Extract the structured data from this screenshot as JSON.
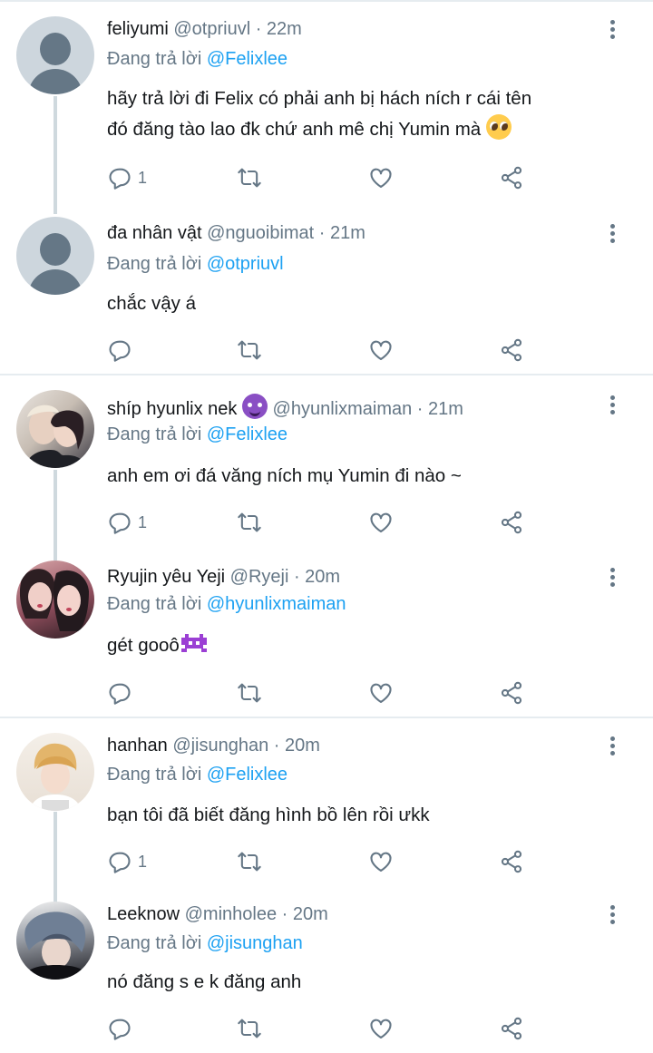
{
  "tweets": [
    {
      "name": "feliyumi",
      "handle": "@otpriuvl · 22m",
      "replying_prefix": "Đang trả lời ",
      "replying_to": "@Felixlee",
      "text_line1": "hãy trả lời đi Felix có phải anh bị hách ních r cái tên",
      "text_line2": "đó đăng tào lao đk chứ anh mê chị Yumin mà",
      "emoji": "pleading-face-emoji",
      "reply_count": "1",
      "avatar": "default-avatar"
    },
    {
      "name": "đa nhân vật",
      "handle": "@nguoibimat · 21m",
      "replying_prefix": "Đang trả lời ",
      "replying_to": "@otpriuvl",
      "text_line1": "chắc vậy á",
      "reply_count": "",
      "avatar": "default-avatar"
    },
    {
      "name": "shíp hyunlix nek",
      "handle": "@hyunlixmaiman · 21m",
      "replying_prefix": "Đang trả lời ",
      "replying_to": "@Felixlee",
      "text_line1": "anh em ơi đá văng ních mụ Yumin đi nào ~",
      "reply_count": "1",
      "emoji": "smiling-devil-emoji",
      "avatar": "photo-avatar"
    },
    {
      "name": "Ryujin yêu Yeji",
      "handle": "@Ryeji · 20m",
      "replying_prefix": "Đang trả lời ",
      "replying_to": "@hyunlixmaiman",
      "text_line1": "gét gooô",
      "emoji": "alien-monster-emoji",
      "reply_count": "",
      "avatar": "photo-avatar"
    },
    {
      "name": "hanhan",
      "handle": "@jisunghan · 20m",
      "replying_prefix": "Đang trả lời ",
      "replying_to": "@Felixlee",
      "text_line1": "bạn tôi đã biết đăng hình bồ lên rồi ưkk",
      "reply_count": "1",
      "avatar": "photo-avatar"
    },
    {
      "name": "Leeknow",
      "handle": "@minholee · 20m",
      "replying_prefix": "Đang trả lời ",
      "replying_to": "@jisunghan",
      "text_line1": "nó đăng s e k đăng anh",
      "reply_count": "",
      "avatar": "photo-avatar"
    }
  ],
  "colors": {
    "accent": "#1da1f2",
    "secondary_text": "#657786",
    "divider": "#e6ecf0",
    "thread_line": "#cfd9de"
  },
  "icons": [
    "reply-icon",
    "retweet-icon",
    "like-icon",
    "share-icon",
    "more-icon"
  ]
}
